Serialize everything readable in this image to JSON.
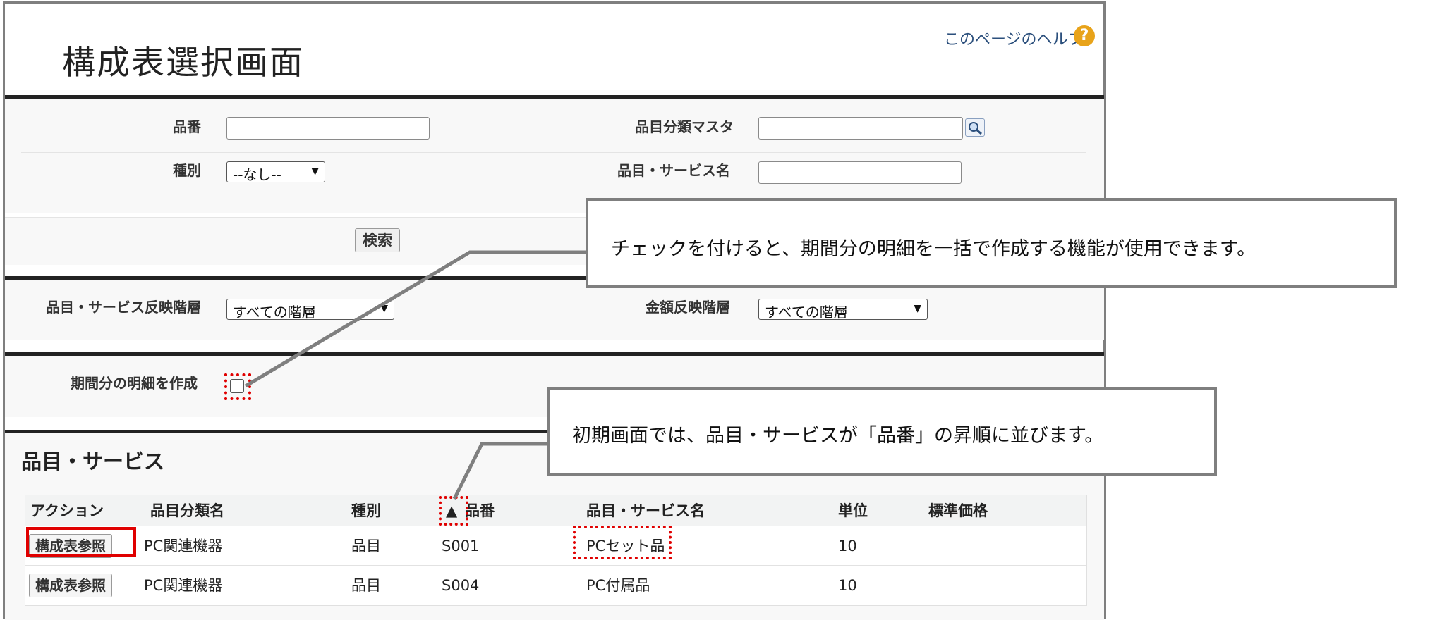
{
  "page": {
    "title": "構成表選択画面",
    "help_link": "このページのヘルプ",
    "help_icon": "?"
  },
  "search_form": {
    "hinban_label": "品番",
    "hinban_value": "",
    "category_master_label": "品目分類マスタ",
    "category_master_value": "",
    "lookup_icon": "magnifier-lookup-icon",
    "type_label": "種別",
    "type_selected": "--なし--",
    "item_name_label": "品目・サービス名",
    "item_name_value": "",
    "search_button": "検索"
  },
  "reflect_form": {
    "item_layer_label": "品目・サービス反映階層",
    "item_layer_selected": "すべての階層",
    "amount_layer_label": "金額反映階層",
    "amount_layer_selected": "すべての階層"
  },
  "period_form": {
    "create_period_label": "期間分の明細を作成",
    "create_period_checked": false
  },
  "results": {
    "section_title": "品目・サービス",
    "sort_indicator": "▲",
    "columns": [
      "アクション",
      "品目分類名",
      "種別",
      "品番",
      "品目・サービス名",
      "単位",
      "標準価格"
    ],
    "rows": [
      {
        "action": "構成表参照",
        "category": "PC関連機器",
        "type": "品目",
        "hinban": "S001",
        "name": "PCセット品",
        "unit": "10",
        "price": ""
      },
      {
        "action": "構成表参照",
        "category": "PC関連機器",
        "type": "品目",
        "hinban": "S004",
        "name": "PC付属品",
        "unit": "10",
        "price": ""
      }
    ]
  },
  "callouts": {
    "checkbox_note": "チェックを付けると、期間分の明細を一括で作成する機能が使用できます。",
    "sort_note": "初期画面では、品目・サービスが「品番」の昇順に並びます。"
  },
  "colors": {
    "highlight_red": "#e00000",
    "callout_border": "#7f7f7f",
    "help_icon": "#e8a31a"
  }
}
